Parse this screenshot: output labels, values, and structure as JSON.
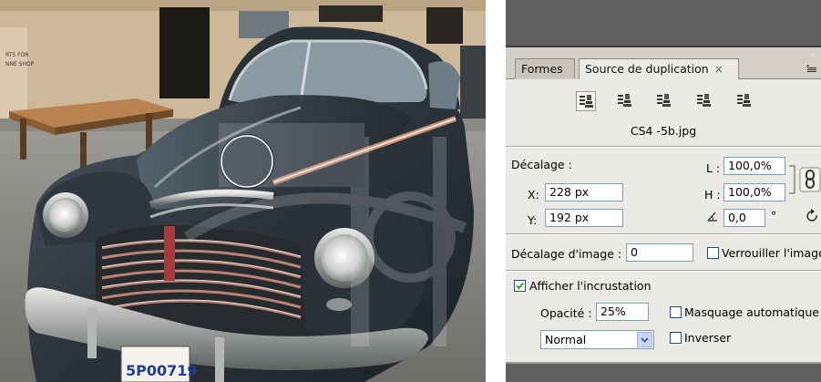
{
  "panel": {
    "tabs": [
      {
        "label": "Formes",
        "active": false
      },
      {
        "label": "Source de duplication",
        "active": true,
        "close_symbol": "×"
      }
    ],
    "clone_sources": [
      {
        "icon": "clone-source-1-icon",
        "active": true
      },
      {
        "icon": "clone-source-2-icon",
        "active": false
      },
      {
        "icon": "clone-source-3-icon",
        "active": false
      },
      {
        "icon": "clone-source-4-icon",
        "active": false
      },
      {
        "icon": "clone-source-5-icon",
        "active": false
      }
    ],
    "filename": "CS4 -5b.jpg",
    "offset": {
      "label": "Décalage :",
      "x_label": "X:",
      "x_value": "228 px",
      "y_label": "Y:",
      "y_value": "192 px",
      "w_label": "L :",
      "w_value": "100,0%",
      "h_label": "H :",
      "h_value": "100,0%",
      "angle_value": "0,0",
      "angle_unit": "°"
    },
    "frame_offset": {
      "label": "Décalage d'image :",
      "value": "0",
      "lock_label": "Verrouiller l'image",
      "lock_checked": false
    },
    "overlay": {
      "show_label": "Afficher l'incrustation",
      "show_checked": true,
      "opacity_label": "Opacité :",
      "opacity_value": "25%",
      "auto_hide_label": "Masquage automatique",
      "auto_hide_checked": false,
      "blend_mode": "Normal",
      "invert_label": "Inverser",
      "invert_checked": false
    }
  },
  "photo": {
    "license_plate": "5P00719",
    "sign_text_1": "RTS FOR",
    "sign_text_2": "NNE SHOP"
  },
  "colors": {
    "panel_bg": "#eceae4",
    "panel_chrome": "#5f5f5f",
    "field_border": "#7f9db9",
    "car_body": "#303941"
  }
}
